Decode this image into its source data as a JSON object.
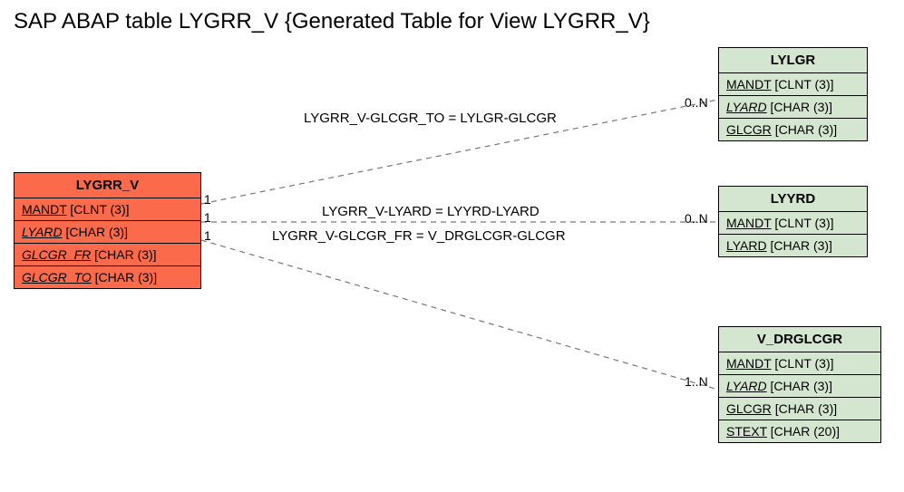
{
  "title": "SAP ABAP table LYGRR_V {Generated Table for View LYGRR_V}",
  "entities": {
    "main": {
      "name": "LYGRR_V",
      "fields": [
        {
          "name": "MANDT",
          "type": "[CLNT (3)]",
          "key": true,
          "fk": false
        },
        {
          "name": "LYARD",
          "type": "[CHAR (3)]",
          "key": true,
          "fk": true
        },
        {
          "name": "GLCGR_FR",
          "type": "[CHAR (3)]",
          "key": true,
          "fk": true
        },
        {
          "name": "GLCGR_TO",
          "type": "[CHAR (3)]",
          "key": true,
          "fk": true
        }
      ]
    },
    "lylgr": {
      "name": "LYLGR",
      "fields": [
        {
          "name": "MANDT",
          "type": "[CLNT (3)]",
          "key": true,
          "fk": false
        },
        {
          "name": "LYARD",
          "type": "[CHAR (3)]",
          "key": true,
          "fk": true
        },
        {
          "name": "GLCGR",
          "type": "[CHAR (3)]",
          "key": true,
          "fk": false
        }
      ]
    },
    "lyyrd": {
      "name": "LYYRD",
      "fields": [
        {
          "name": "MANDT",
          "type": "[CLNT (3)]",
          "key": true,
          "fk": false
        },
        {
          "name": "LYARD",
          "type": "[CHAR (3)]",
          "key": true,
          "fk": false
        }
      ]
    },
    "vdrglcgr": {
      "name": "V_DRGLCGR",
      "fields": [
        {
          "name": "MANDT",
          "type": "[CLNT (3)]",
          "key": true,
          "fk": false
        },
        {
          "name": "LYARD",
          "type": "[CHAR (3)]",
          "key": true,
          "fk": true
        },
        {
          "name": "GLCGR",
          "type": "[CHAR (3)]",
          "key": true,
          "fk": false
        },
        {
          "name": "STEXT",
          "type": "[CHAR (20)]",
          "key": true,
          "fk": false
        }
      ]
    }
  },
  "relations": {
    "r1": {
      "label": "LYGRR_V-GLCGR_TO = LYLGR-GLCGR",
      "left": "1",
      "right": "0..N"
    },
    "r2": {
      "label": "LYGRR_V-LYARD = LYYRD-LYARD",
      "left": "1",
      "right": "0..N"
    },
    "r3": {
      "label": "LYGRR_V-GLCGR_FR = V_DRGLCGR-GLCGR",
      "left": "1",
      "right": "1..N"
    }
  }
}
